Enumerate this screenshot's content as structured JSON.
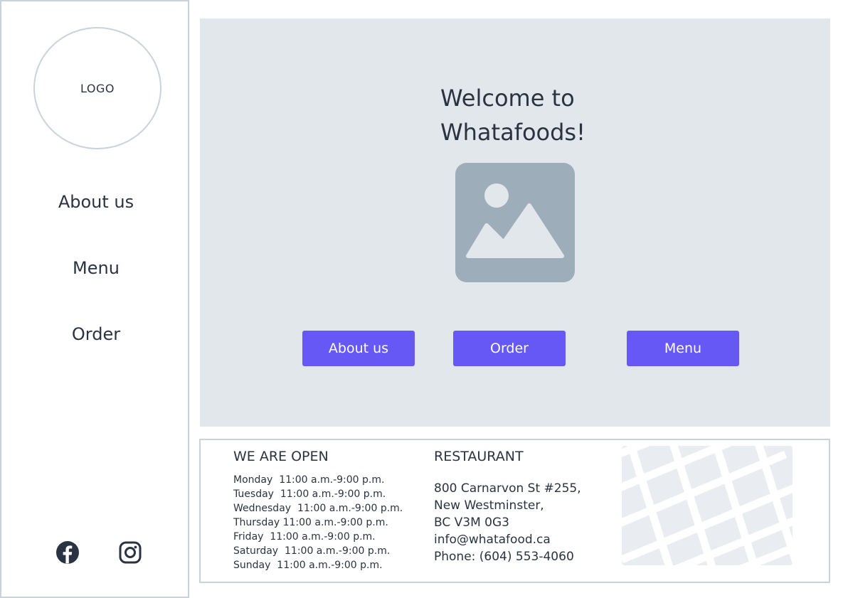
{
  "sidebar": {
    "logo_text": "LOGO",
    "nav": [
      {
        "label": "About us"
      },
      {
        "label": "Menu"
      },
      {
        "label": "Order"
      }
    ],
    "social": [
      "facebook-icon",
      "instagram-icon"
    ]
  },
  "hero": {
    "title_line1": "Welcome to",
    "title_line2": "Whatafoods!",
    "image_icon": "image-placeholder-icon",
    "buttons": [
      {
        "label": "About us"
      },
      {
        "label": "Order"
      },
      {
        "label": "Menu"
      }
    ]
  },
  "footer": {
    "hours_title": "WE ARE OPEN",
    "hours": [
      {
        "day": "Monday",
        "time": "11:00 a.m.-9:00 p.m."
      },
      {
        "day": "Tuesday",
        "time": "11:00 a.m.-9:00 p.m."
      },
      {
        "day": "Wednesday",
        "time": "11:00 a.m.-9:00 p.m."
      },
      {
        "day": "Thursday",
        "time": "11:00 a.m.-9:00 p.m."
      },
      {
        "day": "Friday",
        "time": "11:00 a.m.-9:00 p.m."
      },
      {
        "day": "Saturday",
        "time": "11:00 a.m.-9:00 p.m."
      },
      {
        "day": "Sunday",
        "time": "11:00 a.m.-9:00 p.m."
      }
    ],
    "restaurant_title": "RESTAURANT",
    "address_lines": [
      "800 Carnarvon St #255,",
      "New Westminster,",
      "BC V3M 0G3",
      "info@whatafood.ca",
      "Phone: (604) 553-4060"
    ]
  },
  "colors": {
    "accent": "#6558f5",
    "hero_bg": "#e2e7ec",
    "border": "#c9d3dc",
    "text": "#2a3342",
    "icon_gray": "#9eadba"
  }
}
